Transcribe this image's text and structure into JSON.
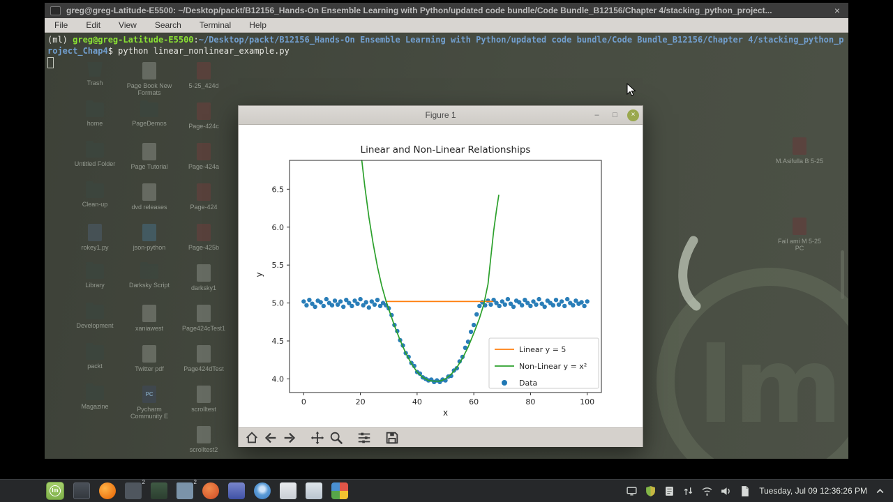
{
  "colors": {
    "fg": "#e8e8e3",
    "green": "#8ae234",
    "blue": "#729fcf",
    "chart_orange": "#ff7f0e",
    "chart_green": "#2ca02c",
    "chart_blue": "#1f77b4",
    "mint_accent": "#8fb04a"
  },
  "terminal": {
    "titlebar": {
      "title": "greg@greg-Latitude-E5500: ~/Desktop/packt/B12156_Hands-On Ensemble Learning with Python/updated code bundle/Code Bundle_B12156/Chapter 4/stacking_python_project...",
      "close": "×"
    },
    "menu": [
      "File",
      "Edit",
      "View",
      "Search",
      "Terminal",
      "Help"
    ],
    "lines": [
      {
        "segments": [
          {
            "t": "(ml) ",
            "c": "fg"
          },
          {
            "t": "greg@greg-Latitude-E5500",
            "c": "green"
          },
          {
            "t": ":",
            "c": "fg"
          },
          {
            "t": "~/Desktop/packt/B12156_Hands-On Ensemble Learning with Python/updated code bundle/Code Bundle_B12156/Chapter 4/stacking_python_p",
            "c": "blue"
          }
        ]
      },
      {
        "segments": [
          {
            "t": "roject_Chap4",
            "c": "blue"
          },
          {
            "t": "$ ",
            "c": "fg"
          },
          {
            "t": "python linear_nonlinear_example.py",
            "c": "fg"
          }
        ]
      }
    ]
  },
  "desktop": {
    "columns": [
      {
        "items": [
          {
            "label": "Trash",
            "kind": "trash",
            "tint": "#3c463e"
          },
          {
            "label": "home",
            "kind": "folder",
            "tint": "#3c463e"
          },
          {
            "label": "Untitled Folder",
            "kind": "folder",
            "tint": "#3c463e"
          },
          {
            "label": "Clean-up",
            "kind": "folder",
            "tint": "#3c463e"
          },
          {
            "label": "rokey1.py",
            "kind": "file",
            "tint": "#49555c"
          },
          {
            "label": "Library",
            "kind": "folder",
            "tint": "#3c463e"
          },
          {
            "label": "Development",
            "kind": "folder",
            "tint": "#3c463e"
          },
          {
            "label": "packt",
            "kind": "folder",
            "tint": "#3c463e"
          },
          {
            "label": "Magazine",
            "kind": "folder",
            "tint": "#3c463e"
          }
        ]
      },
      {
        "items": [
          {
            "label": "Page Book New Formats",
            "kind": "file",
            "tint": "#6f746c"
          },
          {
            "label": "PageDemos",
            "kind": "folder",
            "tint": "#3c463e"
          },
          {
            "label": "Page Tutorial",
            "kind": "file",
            "tint": "#6f746c"
          },
          {
            "label": "dvd releases",
            "kind": "file",
            "tint": "#6f746c"
          },
          {
            "label": "json-python",
            "kind": "file",
            "tint": "#43606c"
          },
          {
            "label": "Darksky Script",
            "kind": "folder",
            "tint": "#3c463e"
          },
          {
            "label": "xaniawest",
            "kind": "file",
            "tint": "#6f746c"
          },
          {
            "label": "Twitter pdf",
            "kind": "file",
            "tint": "#6f746c"
          },
          {
            "label": "Pycharm Community E",
            "kind": "pc",
            "tint": "#3f4852",
            "glyph": "PC"
          }
        ]
      },
      {
        "items": [
          {
            "label": "5-25_424d",
            "kind": "pdf",
            "tint": "#5e403c"
          },
          {
            "label": "Page-424c",
            "kind": "pdf",
            "tint": "#5e403c"
          },
          {
            "label": "Page-424a",
            "kind": "pdf",
            "tint": "#5e403c"
          },
          {
            "label": "Page-424",
            "kind": "pdf",
            "tint": "#5e403c"
          },
          {
            "label": "Page-425b",
            "kind": "pdf",
            "tint": "#5e403c"
          },
          {
            "label": "darksky1",
            "kind": "file",
            "tint": "#6f746c"
          },
          {
            "label": "Page424cTest1",
            "kind": "file",
            "tint": "#6f746c"
          },
          {
            "label": "Page424dTest",
            "kind": "file",
            "tint": "#6f746c"
          },
          {
            "label": "scrolltest",
            "kind": "file",
            "tint": "#6f746c"
          },
          {
            "label": "scrolltest2",
            "kind": "file",
            "tint": "#6f746c"
          }
        ]
      }
    ],
    "right_items": [
      {
        "label": "M.Asifulla B 5-25",
        "kind": "pdf",
        "tint": "#5e403c"
      },
      {
        "label": "Fail ami M 5-25 PC",
        "kind": "pdf",
        "tint": "#5e403c"
      }
    ],
    "watermark_text": "lm"
  },
  "figure": {
    "title": "Figure 1",
    "controls": {
      "minimize": "–",
      "maximize": "□",
      "close": "×"
    },
    "toolbar_icons": [
      "home",
      "back",
      "forward",
      "pan",
      "zoom",
      "configure-subplots",
      "save"
    ],
    "chart_data": {
      "type": "line+scatter",
      "title": "Linear and Non-Linear Relationships",
      "xlabel": "x",
      "ylabel": "y",
      "xlim": [
        -5,
        105
      ],
      "ylim": [
        3.82,
        6.88
      ],
      "xtick_values": [
        0,
        20,
        40,
        60,
        80,
        100
      ],
      "xtick_labels": [
        "0",
        "20",
        "40",
        "60",
        "80",
        "100"
      ],
      "ytick_values": [
        4.0,
        4.5,
        5.0,
        5.5,
        6.0,
        6.5
      ],
      "ytick_labels": [
        "4.0",
        "4.5",
        "5.0",
        "5.5",
        "6.0",
        "6.5"
      ],
      "grid": false,
      "legend_position": "lower right",
      "series": [
        {
          "name": "Linear y = 5",
          "type": "line",
          "color": "#ff7f0e",
          "points": [
            [
              29,
              5.02
            ],
            [
              66.7,
              5.02
            ]
          ]
        },
        {
          "name": "Non-Linear y = x²",
          "type": "line",
          "color": "#2ca02c",
          "points": [
            [
              20.5,
              6.88
            ],
            [
              21.5,
              6.55
            ],
            [
              23,
              6.13
            ],
            [
              24.5,
              5.78
            ],
            [
              26,
              5.48
            ],
            [
              27.5,
              5.23
            ],
            [
              29,
              5.03
            ],
            [
              30,
              4.92
            ],
            [
              32,
              4.7
            ],
            [
              34,
              4.51
            ],
            [
              36,
              4.34
            ],
            [
              38,
              4.2
            ],
            [
              40,
              4.09
            ],
            [
              42,
              4.02
            ],
            [
              44,
              3.98
            ],
            [
              46,
              3.97
            ],
            [
              48,
              3.97
            ],
            [
              50,
              4.0
            ],
            [
              52,
              4.06
            ],
            [
              54,
              4.15
            ],
            [
              56,
              4.27
            ],
            [
              58,
              4.42
            ],
            [
              60,
              4.6
            ],
            [
              62,
              4.8
            ],
            [
              63.5,
              4.98
            ],
            [
              65,
              5.25
            ],
            [
              66,
              5.6
            ],
            [
              67,
              5.95
            ],
            [
              68,
              6.22
            ],
            [
              68.8,
              6.42
            ]
          ]
        },
        {
          "name": "Data",
          "type": "scatter",
          "color": "#1f77b4",
          "x": [
            0,
            1,
            2,
            3,
            4,
            5,
            6,
            7,
            8,
            9,
            10,
            11,
            12,
            13,
            14,
            15,
            16,
            17,
            18,
            19,
            20,
            21,
            22,
            23,
            24,
            25,
            26,
            27,
            28,
            29,
            30,
            31,
            32,
            33,
            34,
            35,
            36,
            37,
            38,
            39,
            40,
            41,
            42,
            43,
            44,
            45,
            46,
            47,
            48,
            49,
            50,
            51,
            52,
            53,
            54,
            55,
            56,
            57,
            58,
            59,
            60,
            61,
            62,
            63,
            64,
            65,
            66,
            67,
            68,
            69,
            70,
            71,
            72,
            73,
            74,
            75,
            76,
            77,
            78,
            79,
            80,
            81,
            82,
            83,
            84,
            85,
            86,
            87,
            88,
            89,
            90,
            91,
            92,
            93,
            94,
            95,
            96,
            97,
            98,
            99,
            100
          ],
          "y": [
            5.02,
            4.97,
            5.04,
            4.99,
            4.95,
            5.03,
            5.01,
            4.96,
            5.05,
            5.0,
            4.97,
            5.03,
            4.98,
            5.02,
            4.95,
            5.04,
            5.0,
            4.96,
            5.03,
            4.99,
            5.05,
            4.97,
            5.01,
            4.94,
            5.02,
            4.98,
            5.04,
            4.96,
            5.0,
            4.97,
            4.93,
            4.84,
            4.71,
            4.63,
            4.51,
            4.44,
            4.34,
            4.29,
            4.21,
            4.17,
            4.09,
            4.07,
            4.02,
            4.0,
            3.98,
            3.99,
            3.96,
            3.98,
            3.96,
            3.99,
            3.98,
            4.03,
            4.04,
            4.11,
            4.14,
            4.23,
            4.29,
            4.41,
            4.49,
            4.62,
            4.71,
            4.85,
            4.96,
            5.01,
            4.97,
            5.03,
            4.98,
            5.04,
            5.0,
            4.96,
            5.02,
            4.98,
            5.05,
            4.99,
            4.95,
            5.03,
            5.01,
            4.97,
            5.04,
            5.0,
            4.96,
            5.02,
            4.98,
            5.05,
            4.99,
            4.95,
            5.03,
            5.0,
            4.97,
            5.04,
            4.98,
            5.02,
            4.96,
            5.05,
            5.0,
            4.97,
            5.03,
            4.99,
            5.01,
            4.96,
            5.02
          ]
        }
      ]
    }
  },
  "taskbar": {
    "launchers": [
      {
        "style": "mint",
        "name": "mint-menu",
        "glyph": "lm"
      },
      {
        "style": "desk",
        "name": "show-desktop"
      },
      {
        "style": "firefox",
        "name": "firefox"
      },
      {
        "style": "win2",
        "name": "window-group",
        "badge": "2"
      },
      {
        "style": "xed",
        "name": "text-editor"
      },
      {
        "style": "folder2",
        "name": "file-manager",
        "badge": "2"
      },
      {
        "style": "orangeapp",
        "name": "software-app"
      },
      {
        "style": "purpleapp",
        "name": "package-app"
      },
      {
        "style": "chrome",
        "name": "chromium"
      },
      {
        "style": "mailA",
        "name": "mail-app"
      },
      {
        "style": "mailB",
        "name": "calendar-app"
      },
      {
        "style": "photos",
        "name": "screenshot-tool"
      }
    ],
    "tray": [
      {
        "glyph": "display",
        "name": "display-tray"
      },
      {
        "glyph": "shield",
        "name": "firewall-tray"
      },
      {
        "glyph": "note",
        "name": "notes-tray"
      },
      {
        "glyph": "net",
        "name": "network-tray"
      },
      {
        "glyph": "wifi",
        "name": "wifi-tray"
      },
      {
        "glyph": "vol",
        "name": "volume-tray"
      },
      {
        "glyph": "doc",
        "name": "document-tray"
      }
    ],
    "clock": "Tuesday, Jul 09 12:36:26 PM"
  }
}
